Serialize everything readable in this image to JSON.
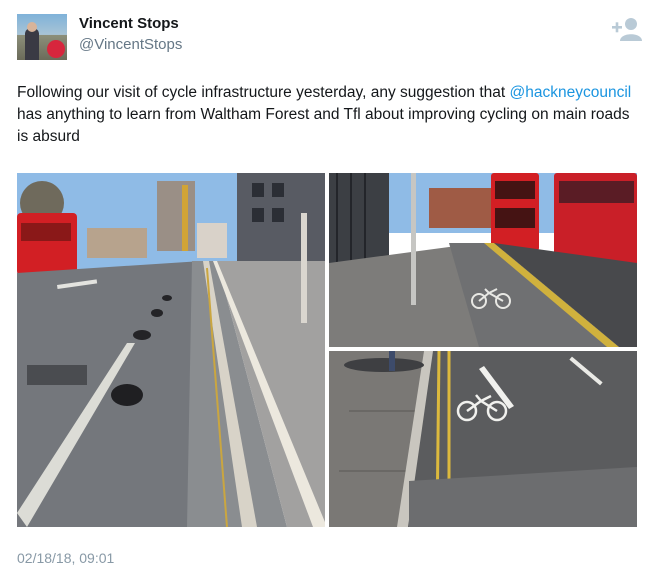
{
  "tweet": {
    "author": {
      "display_name": "Vincent Stops",
      "handle": "@VincentStops"
    },
    "text_before_mention": "Following our visit of cycle infrastructure yesterday, any suggestion that ",
    "mention": "@hackneycouncil",
    "text_after_mention": " has anything to learn from Waltham Forest and Tfl about improving cycling on main roads is absurd",
    "timestamp": "02/18/18, 09:01",
    "media": [
      {
        "icon": "photo-segregated-cycle-lane"
      },
      {
        "icon": "photo-bus-stop-bypass"
      },
      {
        "icon": "photo-cycle-lane-symbol"
      }
    ]
  },
  "colors": {
    "link": "#1b95e0",
    "secondary_text": "#657786",
    "timestamp": "#8899a6",
    "bus_red": "#d21f24"
  },
  "icons": {
    "follow": "add-user-icon"
  }
}
